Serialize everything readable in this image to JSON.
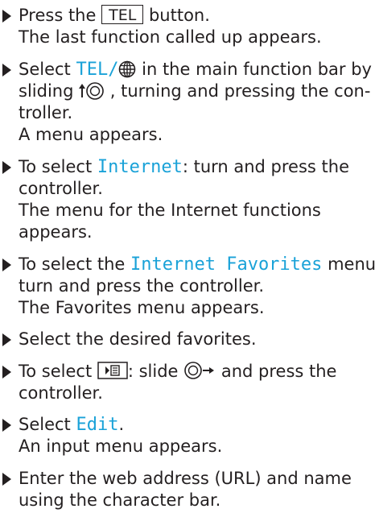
{
  "steps": [
    {
      "lines": [
        {
          "pre": "Press the ",
          "button": "TEL",
          "post": " button."
        },
        {
          "text": "The last function called up appears."
        }
      ]
    },
    {
      "lines": [
        {
          "pre": "Select ",
          "hl": "TEL/",
          "post": " in the main function bar by"
        },
        {
          "pre": "sliding ",
          "post": " , turning and pressing the con-"
        },
        {
          "text": "troller."
        },
        {
          "text": "A menu appears."
        }
      ]
    },
    {
      "lines": [
        {
          "pre": "To select ",
          "hl": "Internet",
          "post": ": turn and press the"
        },
        {
          "text": "controller."
        },
        {
          "text": "The menu for the Internet functions"
        },
        {
          "text": "appears."
        }
      ]
    },
    {
      "lines": [
        {
          "pre": "To select the ",
          "hl": "Internet Favorites",
          "post": " menu:"
        },
        {
          "text": "turn and press the controller."
        },
        {
          "text": "The Favorites menu appears."
        }
      ]
    },
    {
      "lines": [
        {
          "text": "Select the desired favorites."
        }
      ]
    },
    {
      "lines": [
        {
          "pre": "To select ",
          "mid": ": slide ",
          "post": " and press the"
        },
        {
          "text": "controller."
        }
      ]
    },
    {
      "lines": [
        {
          "pre": "Select ",
          "hl": "Edit",
          "post": "."
        },
        {
          "text": "An input menu appears."
        }
      ]
    },
    {
      "lines": [
        {
          "text": "Enter the web address (URL) and name"
        },
        {
          "text": "using the character bar."
        }
      ]
    }
  ],
  "icons": {
    "globe": "globe-icon",
    "controller_slide_up": "controller-slide-up-icon",
    "controller_slide_right": "controller-slide-right-icon",
    "menu_button": "menu-arrow-button-icon"
  },
  "colors": {
    "text": "#231f20",
    "highlight": "#1aa2d8"
  }
}
